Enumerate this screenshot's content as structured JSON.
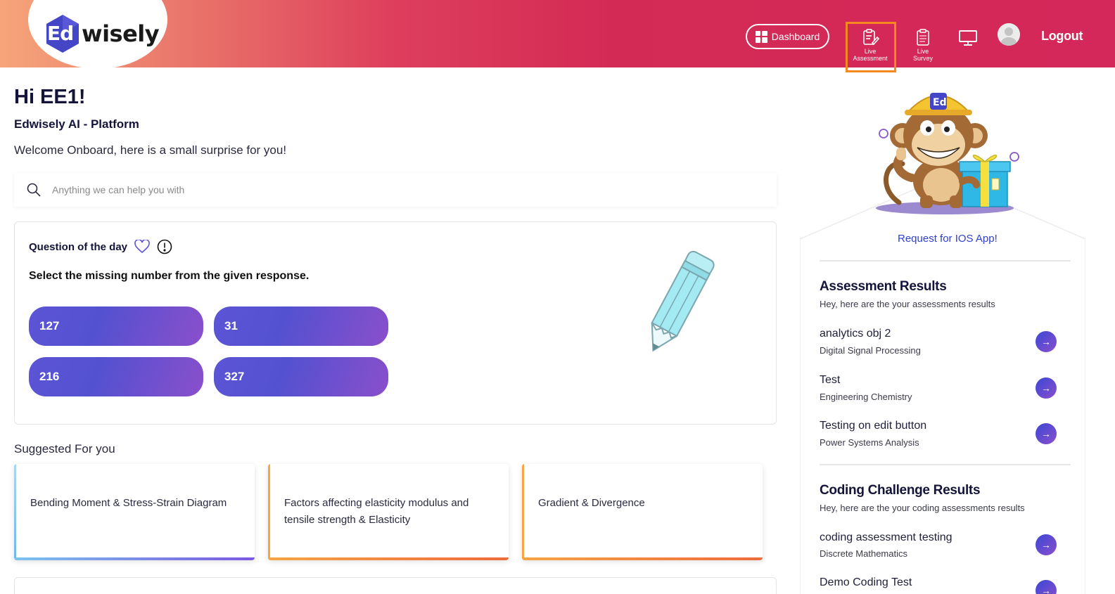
{
  "header": {
    "logo_badge": "Ed",
    "logo_word": "wisely",
    "dashboard_label": "Dashboard",
    "live_assessment_line1": "Live",
    "live_assessment_line2": "Assessment",
    "live_survey_line1": "Live",
    "live_survey_line2": "Survey",
    "logout_label": "Logout"
  },
  "greeting": {
    "hi": "Hi EE1!",
    "platform": "Edwisely AI - Platform",
    "welcome": "Welcome Onboard, here is a small surprise for you!"
  },
  "search": {
    "placeholder": "Anything we can help you with"
  },
  "question": {
    "title": "Question of the day",
    "text": "Select the missing number from the given response.",
    "options": [
      "127",
      "31",
      "216",
      "327"
    ]
  },
  "suggested": {
    "title": "Suggested For you",
    "cards": [
      "Bending Moment & Stress-Strain Diagram",
      "Factors affecting elasticity modulus and tensile strength & Elasticity",
      "Gradient & Divergence"
    ]
  },
  "right_panel": {
    "mascot_badge": "Ed",
    "ios_link": "Request for IOS App!",
    "assessment": {
      "title": "Assessment Results",
      "subtitle": "Hey, here are the your assessments results",
      "items": [
        {
          "name": "analytics obj 2",
          "subject": "Digital Signal Processing"
        },
        {
          "name": "Test",
          "subject": "Engineering Chemistry"
        },
        {
          "name": "Testing on edit button",
          "subject": "Power Systems Analysis"
        }
      ]
    },
    "coding": {
      "title": "Coding Challenge Results",
      "subtitle": "Hey, here are the your coding assessments results",
      "items": [
        {
          "name": "coding assessment testing",
          "subject": "Discrete Mathematics"
        },
        {
          "name": "Demo Coding Test",
          "subject": ""
        }
      ]
    }
  },
  "colors": {
    "header_start": "#f6a57a",
    "header_end": "#d4285a",
    "accent_purple": "#5c55d6",
    "highlight_orange": "#f5891f",
    "link_blue": "#2f3fcf"
  },
  "icons": [
    "search-icon",
    "heart-icon",
    "info-icon",
    "dashboard-grid-icon",
    "clipboard-edit-icon",
    "clipboard-list-icon",
    "monitor-icon",
    "user-avatar-icon",
    "arrow-right-icon",
    "pencil-illustration",
    "monkey-mascot-illustration"
  ]
}
